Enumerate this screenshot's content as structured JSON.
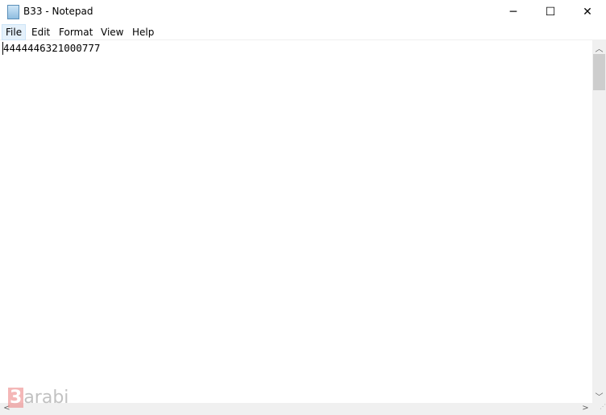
{
  "window": {
    "title": "B33 - Notepad",
    "minimize": "─",
    "maximize": "☐",
    "close": "✕"
  },
  "menu": [
    {
      "label": "File"
    },
    {
      "label": "Edit"
    },
    {
      "label": "Format"
    },
    {
      "label": "View"
    },
    {
      "label": "Help"
    }
  ],
  "editor": {
    "content": "4444446321000777"
  },
  "watermark": {
    "text": "3arabi"
  }
}
